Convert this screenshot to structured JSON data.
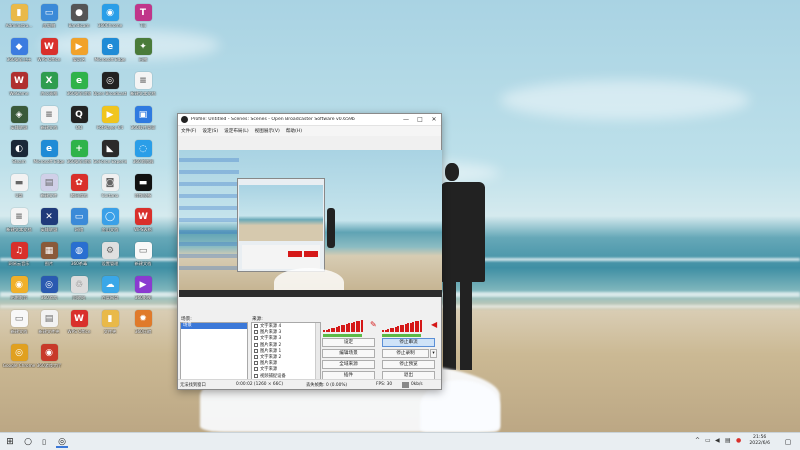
{
  "desktop": {
    "icons": [
      {
        "label": "Administra...",
        "icon": "folder-icon",
        "color": "#e9b949",
        "glyph": "▮"
      },
      {
        "label": "此电脑",
        "icon": "computer-icon",
        "color": "#3b8ad8",
        "glyph": "▭"
      },
      {
        "label": "Bandicam",
        "icon": "camera-app-icon",
        "color": "#555555",
        "glyph": "●"
      },
      {
        "label": "360Chrome",
        "icon": "browser-icon",
        "color": "#2a9ee8",
        "glyph": "◉"
      },
      {
        "label": "Tiji",
        "icon": "media-app-icon",
        "color": "#c0358a",
        "glyph": "T"
      },
      {
        "label": "360安全卫士",
        "icon": "shield-icon",
        "color": "#3c7ce0",
        "glyph": "◆"
      },
      {
        "label": "WPS Office",
        "icon": "office-app-icon",
        "color": "#d9302b",
        "glyph": "W"
      },
      {
        "label": "爱奇艺",
        "icon": "video-app-icon",
        "color": "#f1a22a",
        "glyph": "▶"
      },
      {
        "label": "Microsoft Edge",
        "icon": "edge-icon",
        "color": "#1f8bd6",
        "glyph": "e"
      },
      {
        "label": "迅雷",
        "icon": "game-app-icon",
        "color": "#4a7b3a",
        "glyph": "✦"
      },
      {
        "label": "WeGame",
        "icon": "tool-app-icon",
        "color": "#b03030",
        "glyph": "W"
      },
      {
        "label": "办公表格",
        "icon": "spreadsheet-icon",
        "color": "#2f9d4f",
        "glyph": "X"
      },
      {
        "label": "360安全浏览",
        "icon": "green-app-icon",
        "color": "#2fb34a",
        "glyph": "e"
      },
      {
        "label": "Open Broadcaster",
        "icon": "obs-icon",
        "color": "#222222",
        "glyph": "◎"
      },
      {
        "label": "新建文本文档",
        "icon": "document-icon",
        "color": "#f4f4f4",
        "glyph": "≡"
      },
      {
        "label": "英雄联盟",
        "icon": "game-app-icon",
        "color": "#3a5a3a",
        "glyph": "◈"
      },
      {
        "label": "新建文档",
        "icon": "document-icon",
        "color": "#f4f4f4",
        "glyph": "≡"
      },
      {
        "label": "QQ",
        "icon": "qq-icon",
        "color": "#222222",
        "glyph": "Q"
      },
      {
        "label": "PotPlayer 64",
        "icon": "player-icon",
        "color": "#f0c51e",
        "glyph": "▶"
      },
      {
        "label": "360软件管家",
        "icon": "store-icon",
        "color": "#2f7ae0",
        "glyph": "▣"
      },
      {
        "label": "Steam",
        "icon": "steam-icon",
        "color": "#1b2838",
        "glyph": "◐"
      },
      {
        "label": "Microsoft Edge",
        "icon": "edge-icon",
        "color": "#1f8bd6",
        "glyph": "e"
      },
      {
        "label": "360安全浏览",
        "icon": "green-app-icon",
        "color": "#2fb34a",
        "glyph": "+"
      },
      {
        "label": "GeForce Experience",
        "icon": "nvidia-icon",
        "color": "#2b2b2b",
        "glyph": "◣"
      },
      {
        "label": "360浏览器",
        "icon": "browser-icon",
        "color": "#2a9ee8",
        "glyph": "◌"
      },
      {
        "label": "U盘",
        "icon": "drive-icon",
        "color": "#f2f2f2",
        "glyph": "▬"
      },
      {
        "label": "新建文件",
        "icon": "file-icon",
        "color": "#d0d0e8",
        "glyph": "▤"
      },
      {
        "label": "腾讯游戏",
        "icon": "tencent-icon",
        "color": "#d9302b",
        "glyph": "✿"
      },
      {
        "label": "Cortana",
        "icon": "cortana-icon",
        "color": "#f0f0f0",
        "glyph": "◙"
      },
      {
        "label": "音频设备",
        "icon": "audio-icon",
        "color": "#111111",
        "glyph": "▬"
      },
      {
        "label": "新建文本文档",
        "icon": "document-icon",
        "color": "#f4f4f4",
        "glyph": "≡"
      },
      {
        "label": "英雄联盟",
        "icon": "game-app-icon",
        "color": "#1f3a7a",
        "glyph": "✕"
      },
      {
        "label": "网络",
        "icon": "network-icon",
        "color": "#3b8ad8",
        "glyph": "▭"
      },
      {
        "label": "金山文档",
        "icon": "cloud-doc-icon",
        "color": "#3aa0e8",
        "glyph": "◯"
      },
      {
        "label": "WPS表格",
        "icon": "wps-icon",
        "color": "#d9302b",
        "glyph": "W"
      },
      {
        "label": "网易云音乐",
        "icon": "music-icon",
        "color": "#d9302b",
        "glyph": "♫"
      },
      {
        "label": "图片",
        "icon": "image-icon",
        "color": "#8a5a3a",
        "glyph": "▦"
      },
      {
        "label": "360杀毒",
        "icon": "antivirus-icon",
        "color": "#2a6fd0",
        "glyph": "◍"
      },
      {
        "label": "设置管理",
        "icon": "settings-icon",
        "color": "#e0e0e0",
        "glyph": "⚙"
      },
      {
        "label": "新建文档",
        "icon": "document-icon",
        "color": "#f8f8f8",
        "glyph": "▭"
      },
      {
        "label": "迅雷影音",
        "icon": "video-app-icon",
        "color": "#f0b02a",
        "glyph": "◉"
      },
      {
        "label": "360游戏",
        "icon": "game-app-icon",
        "color": "#2a5ab0",
        "glyph": "◎"
      },
      {
        "label": "回收站",
        "icon": "recycle-bin-icon",
        "color": "#dcdcdc",
        "glyph": "♲"
      },
      {
        "label": "百度网盘",
        "icon": "cloud-drive-icon",
        "color": "#3aa7e8",
        "glyph": "☁"
      },
      {
        "label": "360影视",
        "icon": "video-app-icon",
        "color": "#8a3ad0",
        "glyph": "▶"
      },
      {
        "label": "新建文档",
        "icon": "document-icon",
        "color": "#f8f8f8",
        "glyph": "▭"
      },
      {
        "label": "新建文件夹",
        "icon": "file-icon",
        "color": "#f2f2f2",
        "glyph": "▤"
      },
      {
        "label": "WPS Office",
        "icon": "wps-icon",
        "color": "#d9302b",
        "glyph": "W"
      },
      {
        "label": "文件夹",
        "icon": "folder-icon",
        "color": "#e9b949",
        "glyph": "▮"
      },
      {
        "label": "360压缩",
        "icon": "archive-icon",
        "color": "#e07a2a",
        "glyph": "✹"
      },
      {
        "label": "Google Chrome",
        "icon": "chrome-icon",
        "color": "#e0a020",
        "glyph": "◎"
      },
      {
        "label": "360游戏大厅",
        "icon": "game-app-icon",
        "color": "#c83a2a",
        "glyph": "◉"
      }
    ]
  },
  "obs": {
    "title": "Profile: Untitled - Scenes: Scenes - Open Broadcaster Software v0.659b",
    "window_controls": {
      "minimize": "—",
      "maximize": "□",
      "close": "✕"
    },
    "menu": [
      "文件(F)",
      "设定(S)",
      "设定布局(L)",
      "视图展示(V)",
      "帮助(H)"
    ],
    "scenes_label": "场景:",
    "sources_label": "来源:",
    "scenes": [
      "场景"
    ],
    "sources": [
      "文字来源 4",
      "图片来源 3",
      "文字来源 3",
      "图片来源 2",
      "图片来源 1",
      "文字来源 2",
      "图片来源",
      "文字来源",
      "视频捕捉设备"
    ],
    "buttons": {
      "settings": "设定",
      "stop_stream": "停止串流",
      "edit_scene": "编辑场景",
      "stop_record": "停止录制",
      "global_sources": "全域来源",
      "stop_preview": "停止预览",
      "plugins": "插件",
      "exit": "退出"
    },
    "status": {
      "dropped": "无法找到窗口",
      "time": "0:00:02 (1260 × 66C)",
      "lost": "丢失帧数: 0 (0.00%)",
      "fps": "FPS: 30",
      "bitrate": "0kb/s"
    },
    "audio": {
      "mic_level": 0.85,
      "desktop_level": 0.85
    }
  },
  "taskbar": {
    "start_icon": "windows-icon",
    "pinned": [
      "search-icon",
      "task-view-icon",
      "obs-taskbar-icon"
    ],
    "time": "21:56",
    "date": "2022/6/6"
  }
}
